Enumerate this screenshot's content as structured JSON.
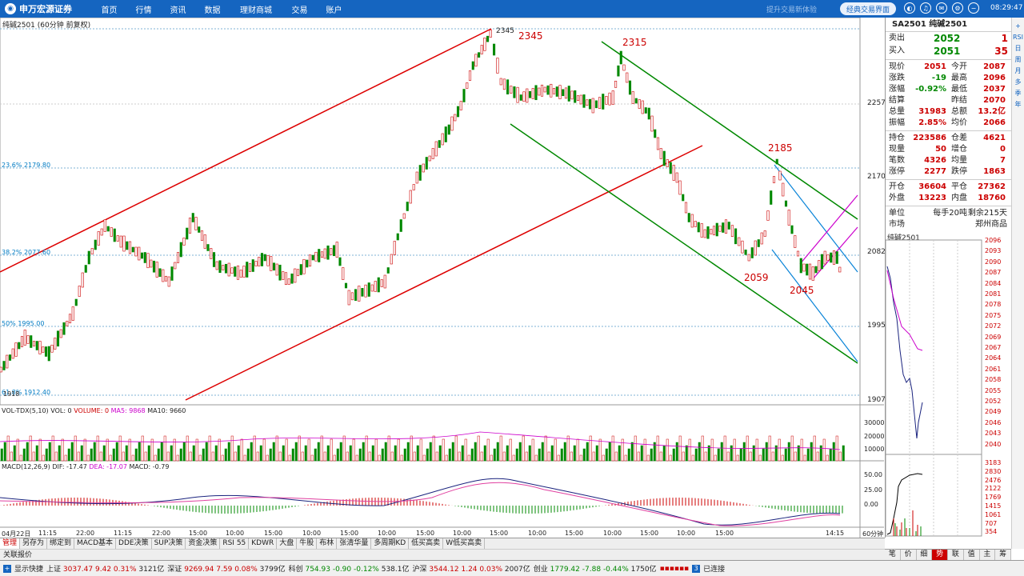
{
  "topbar": {
    "logo": "申万宏源证券",
    "nav": [
      "首页",
      "行情",
      "资讯",
      "数据",
      "理财商城",
      "交易",
      "账户"
    ],
    "slogan": "提升交易新体验",
    "classic": "经典交易界面",
    "time": "08:29:47"
  },
  "chart": {
    "title": "纯碱2501 (60分钟 前复权)",
    "peak": "2345",
    "annotations": [
      "2345",
      "2315",
      "2185",
      "2059",
      "2045"
    ],
    "fib": [
      "23.6% 2179.80",
      "38.2% 2077.60",
      "50% 1995.00",
      "61.8% 1912.40"
    ],
    "axis": [
      "2257",
      "2170",
      "2082",
      "1995",
      "1907"
    ],
    "low": "1918",
    "vol_label": "VOL-TDX(5,10)",
    "vol_items": [
      "VOL: 0",
      "VOLUME: 0",
      "MA5: 9868",
      "MA10: 9660"
    ],
    "vol_axis": [
      "30000",
      "20000",
      "10000"
    ],
    "macd_label": "MACD(12,26,9)",
    "macd_items": [
      "DIF: -17.47",
      "DEA: -17.07",
      "MACD: -0.79"
    ],
    "macd_axis": [
      "50.00",
      "25.00",
      "0.00"
    ],
    "time_axis": [
      "04月22日",
      "11:15",
      "22:00",
      "11:15",
      "22:00",
      "15:00",
      "10:00",
      "15:00",
      "10:00",
      "15:00",
      "10:00",
      "15:00",
      "10:00",
      "15:00",
      "10:00",
      "15:00",
      "10:00",
      "15:00",
      "10:00",
      "15:00",
      "14:15"
    ],
    "period": "60分钟"
  },
  "panel": {
    "title": "SA2501 纯碱2501",
    "sell": {
      "label": "卖出",
      "price": "2052",
      "qty": "1"
    },
    "buy": {
      "label": "买入",
      "price": "2051",
      "qty": "35"
    },
    "rows": [
      [
        "现价",
        "2051",
        "今开",
        "2087"
      ],
      [
        "涨跌",
        "-19",
        "最高",
        "2096"
      ],
      [
        "涨幅",
        "-0.92%",
        "最低",
        "2037"
      ],
      [
        "结算",
        "",
        "昨结",
        "2070"
      ],
      [
        "总量",
        "31983",
        "总额",
        "13.2亿"
      ],
      [
        "振幅",
        "2.85%",
        "均价",
        "2066"
      ]
    ],
    "rows2": [
      [
        "持仓",
        "223586",
        "仓差",
        "4621"
      ],
      [
        "现量",
        "50",
        "增仓",
        "0"
      ],
      [
        "笔数",
        "4326",
        "均量",
        "7"
      ],
      [
        "涨停",
        "2277",
        "跌停",
        "1863"
      ]
    ],
    "rows3": [
      [
        "开仓",
        "36604",
        "平仓",
        "27362"
      ],
      [
        "外盘",
        "13223",
        "内盘",
        "18760"
      ]
    ],
    "unit": [
      "单位",
      "每手20吨",
      "剩余215天"
    ],
    "market": [
      "市场",
      "郑州商品"
    ]
  },
  "mini": {
    "title": "纯碱2501",
    "axis": [
      "2096",
      "2093",
      "2090",
      "2087",
      "2084",
      "2081",
      "2078",
      "2075",
      "2072",
      "2069",
      "2067",
      "2064",
      "2061",
      "2058",
      "2055",
      "2052",
      "2049",
      "2046",
      "2043",
      "2040",
      "3183",
      "2830",
      "2476",
      "2122",
      "1769",
      "1415",
      "1061",
      "707",
      "354"
    ]
  },
  "rside": [
    "+",
    "RSI",
    "日",
    "周",
    "月",
    "多",
    "季",
    "年"
  ],
  "tabs": [
    "管理",
    "另存为",
    "绑定到",
    "MACD基本",
    "DDE决策",
    "SUP决策",
    "资金决策",
    "RSI 55",
    "KDWR",
    "大盘",
    "牛股",
    "布林",
    "张清华量",
    "多周期KD",
    "低买高卖",
    "W低买高卖"
  ],
  "rtabs": [
    "笔",
    "价",
    "细",
    "势",
    "联",
    "值",
    "主",
    "筹"
  ],
  "fav": "关联报价",
  "status": {
    "show": "显示快捷",
    "sh": "上证",
    "sh_val": "3037.47",
    "sh_chg": "9.42",
    "sh_pct": "0.31%",
    "sh_amt": "3121亿",
    "sz": "深证",
    "sz_val": "9269.94",
    "sz_chg": "7.59",
    "sz_pct": "0.08%",
    "sz_amt": "3799亿",
    "kc": "科创",
    "kc_val": "754.93",
    "kc_chg": "-0.90",
    "kc_pct": "-0.12%",
    "kc_amt": "538.1亿",
    "hs": "沪深",
    "hs_val": "3544.12",
    "hs_chg": "1.24",
    "hs_pct": "0.03%",
    "hs_amt": "2007亿",
    "cy": "创业",
    "cy_val": "1779.42",
    "cy_chg": "-7.88",
    "cy_pct": "-0.44%",
    "cy_amt": "1750亿",
    "conn_num": "3",
    "conn": "已连接"
  }
}
